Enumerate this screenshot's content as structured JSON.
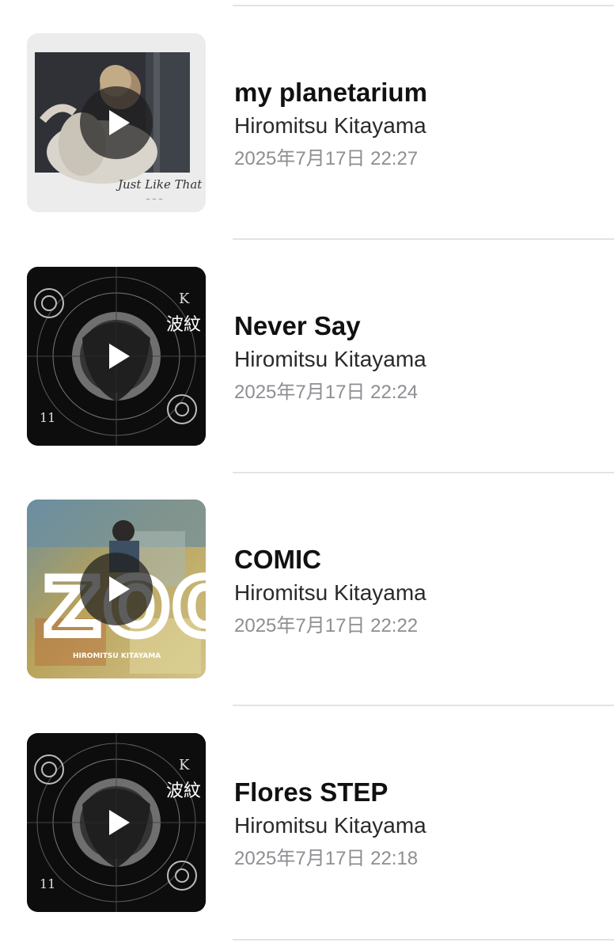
{
  "songs": [
    {
      "title": "my planetarium",
      "artist": "Hiromitsu Kitayama",
      "date": "2025年7月17日 22:27",
      "artwork_icon": "polaroid-portrait-artwork",
      "artwork_text": "Just Like That",
      "play_icon": "play-icon"
    },
    {
      "title": "Never Say",
      "artist": "Hiromitsu Kitayama",
      "date": "2025年7月17日 22:24",
      "artwork_icon": "celestial-circles-artwork",
      "artwork_text": "波紋",
      "play_icon": "play-icon"
    },
    {
      "title": "COMIC",
      "artist": "Hiromitsu Kitayama",
      "date": "2025年7月17日 22:22",
      "artwork_icon": "zoo-collage-artwork",
      "artwork_text": "ZOO",
      "artwork_subtext": "HIROMITSU KITAYAMA",
      "play_icon": "play-icon"
    },
    {
      "title": "Flores STEP",
      "artist": "Hiromitsu Kitayama",
      "date": "2025年7月17日 22:18",
      "artwork_icon": "celestial-circles-artwork",
      "artwork_text": "波紋",
      "play_icon": "play-icon"
    }
  ],
  "colors": {
    "divider": "#e3e3e6",
    "title": "#111111",
    "artist": "#2a2a2a",
    "date": "#8e8e93",
    "play_overlay": "rgba(30,30,30,0.72)"
  }
}
